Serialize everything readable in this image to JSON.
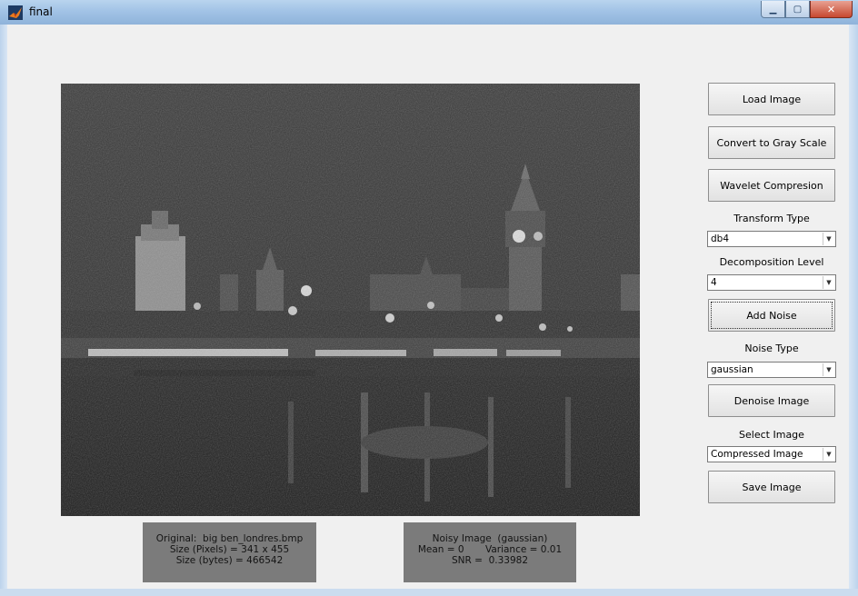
{
  "window": {
    "title": "final"
  },
  "toolbar": {
    "load_image": "Load Image",
    "convert_gray": "Convert to Gray Scale",
    "wavelet_compression": "Wavelet Compresion",
    "transform_type_label": "Transform Type",
    "transform_type_value": "db4",
    "decomposition_level_label": "Decomposition Level",
    "decomposition_level_value": "4",
    "add_noise": "Add Noise",
    "noise_type_label": "Noise Type",
    "noise_type_value": "gaussian",
    "denoise_image": "Denoise Image",
    "select_image_label": "Select Image",
    "select_image_value": "Compressed Image",
    "save_image": "Save Image"
  },
  "info": {
    "original": {
      "line1": "Original:  big ben_londres.bmp",
      "line2": "Size (Pixels) = 341 x 455",
      "line3": "Size (bytes) = 466542"
    },
    "noisy": {
      "line1": "Noisy Image  (gaussian)",
      "line2": "Mean = 0       Variance = 0.01",
      "line3": "SNR =  0.33982"
    }
  },
  "image": {
    "content": "noisy-grayscale-photo-big-ben-westminster-bridge"
  },
  "colors": {
    "title_bar": "#a2c3e6",
    "window_bg": "#f0f0f0",
    "info_box": "#7b7b7b"
  }
}
